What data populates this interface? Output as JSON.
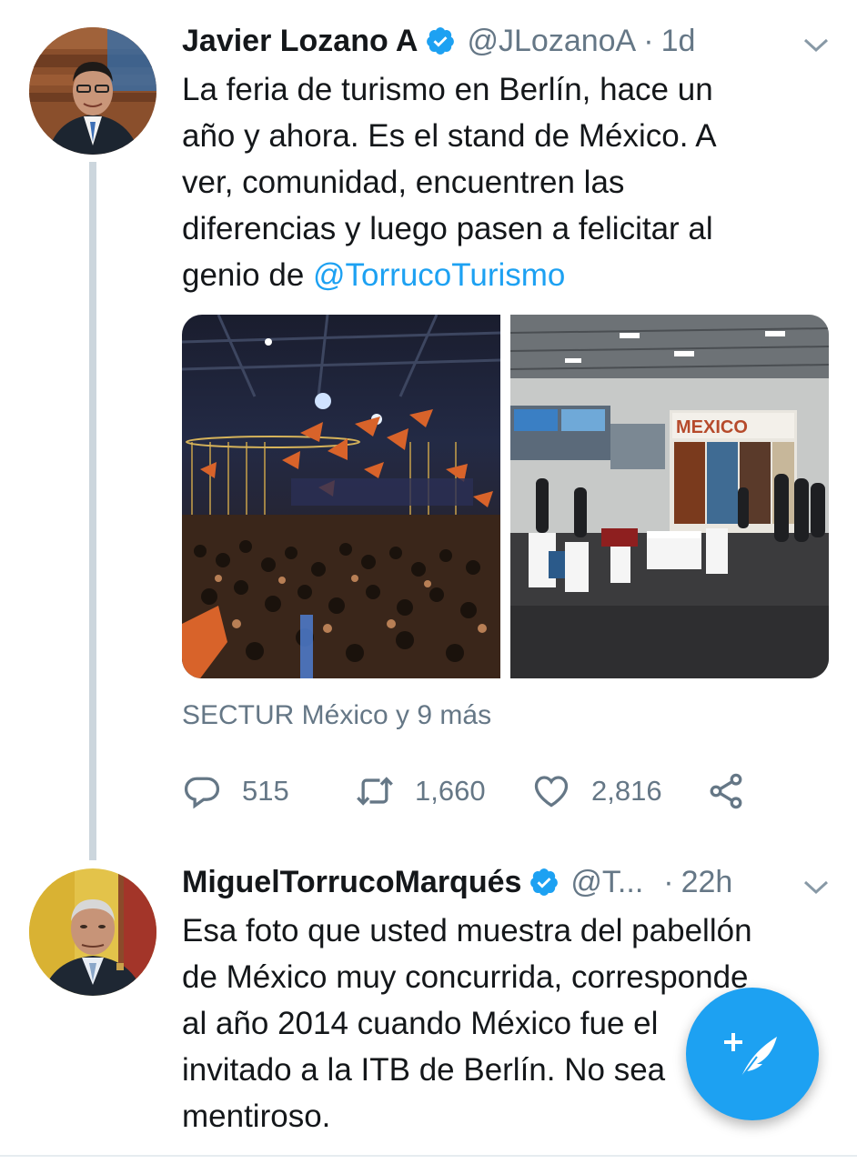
{
  "tweets": [
    {
      "author_name": "Javier Lozano A",
      "handle": "@JLozanoA",
      "separator": "·",
      "time": "1d",
      "text_lines": [
        "La feria de turismo en Berlín, hace un",
        "año y ahora. Es el stand de México. A",
        "ver, comunidad, encuentren las",
        "diferencias y luego pasen a felicitar al"
      ],
      "text_last_prefix": "genio de ",
      "mention": "@TorrucoTurismo",
      "media_right_sign": "MEXICO",
      "liked_by": "SECTUR México y 9 más",
      "replies": "515",
      "retweets": "1,660",
      "likes": "2,816"
    },
    {
      "author_name": "MiguelTorrucoMarqués",
      "handle": "@T...",
      "separator": "·",
      "time": "22h",
      "text_lines": [
        "Esa foto que usted muestra del pabellón",
        "de México muy concurrida, corresponde",
        "al año 2014 cuando México fue el",
        "invitado a la ITB de Berlín. No sea",
        "mentiroso."
      ]
    }
  ],
  "colors": {
    "twitter_blue": "#1da1f2",
    "secondary_text": "#657786",
    "thread_line": "#ccd6dd"
  },
  "icons": {
    "verified": "verified-badge-icon",
    "caret": "chevron-down-icon",
    "reply": "reply-icon",
    "retweet": "retweet-icon",
    "like": "heart-icon",
    "share": "share-icon",
    "compose": "compose-tweet-icon"
  }
}
